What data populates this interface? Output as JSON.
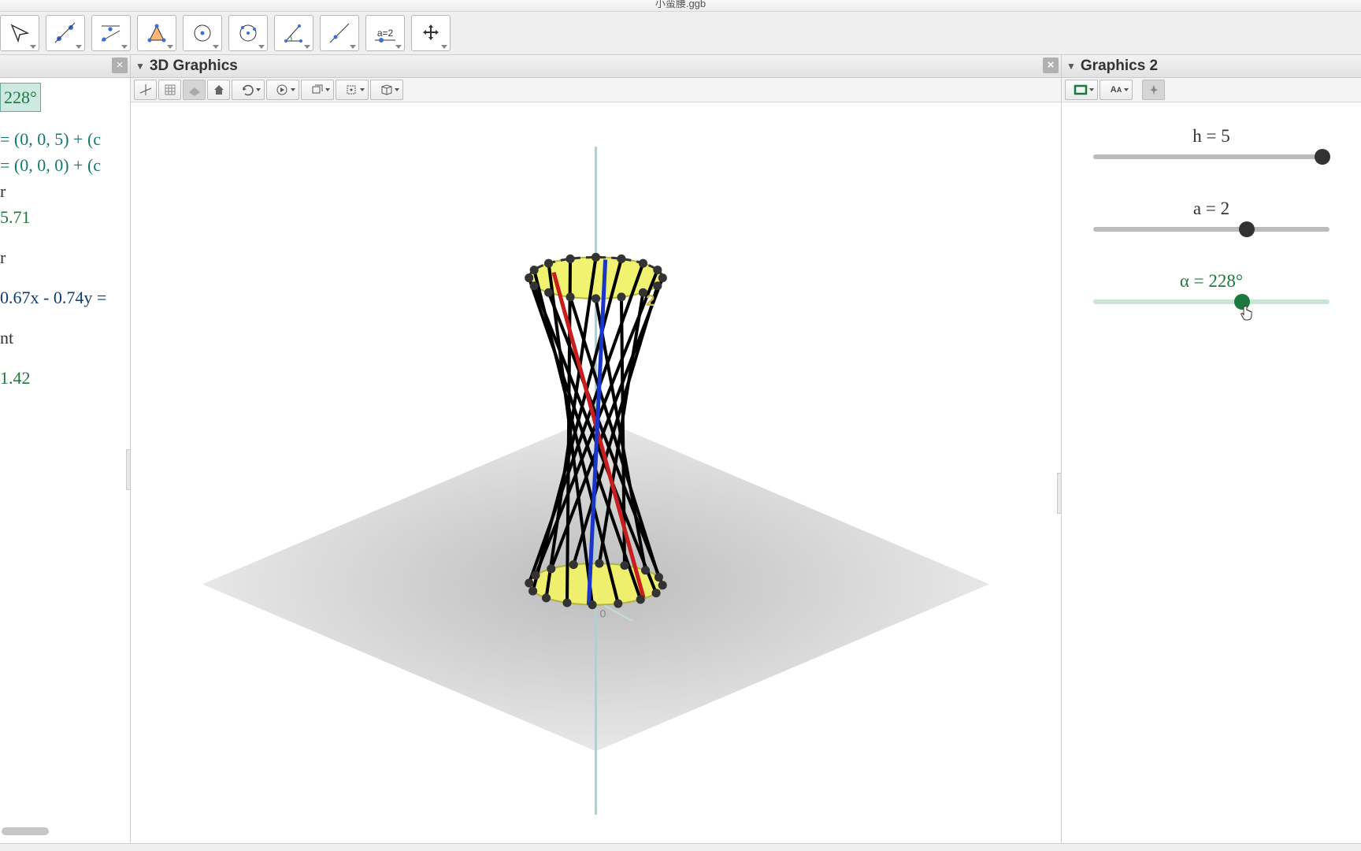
{
  "window": {
    "title": "小蛮腰.ggb"
  },
  "toolbar": [
    {
      "name": "move-tool"
    },
    {
      "name": "point-tool"
    },
    {
      "name": "line-tool"
    },
    {
      "name": "perpendicular-tool"
    },
    {
      "name": "polygon-tool"
    },
    {
      "name": "circle-tool"
    },
    {
      "name": "conic-tool"
    },
    {
      "name": "angle-tool"
    },
    {
      "name": "slider-tool",
      "label": "a=2"
    },
    {
      "name": "pan-tool"
    }
  ],
  "panels": {
    "algebra": {
      "close_label": "×",
      "lines": [
        {
          "text": "228°",
          "cls": "alg-green alg-high"
        },
        {
          "text": "",
          "cls": ""
        },
        {
          "text": " = (0, 0, 5) + (c",
          "cls": "alg-teal"
        },
        {
          "text": " = (0, 0, 0) + (c",
          "cls": "alg-teal"
        },
        {
          "text": "r",
          "cls": ""
        },
        {
          "text": "5.71",
          "cls": "alg-green"
        },
        {
          "text": "",
          "cls": ""
        },
        {
          "text": "r",
          "cls": ""
        },
        {
          "text": "",
          "cls": ""
        },
        {
          "text": "0.67x - 0.74y =",
          "cls": "alg-dark"
        },
        {
          "text": "",
          "cls": ""
        },
        {
          "text": "nt",
          "cls": ""
        },
        {
          "text": "",
          "cls": ""
        },
        {
          "text": "1.42",
          "cls": "alg-green"
        }
      ]
    },
    "view3d": {
      "title": "3D Graphics",
      "sub_buttons": [
        "axes",
        "grid",
        "plane",
        "home",
        "rot",
        "anim",
        "proj",
        "clip",
        "view"
      ],
      "points_label": "2"
    },
    "graphics2": {
      "title": "Graphics 2",
      "sliders": [
        {
          "name": "h",
          "label": "h = 5",
          "value": 5,
          "min": 0,
          "max": 5,
          "pos": 0.97,
          "color": "dark"
        },
        {
          "name": "a",
          "label": "a = 2",
          "value": 2,
          "min": 0,
          "max": 3,
          "pos": 0.65,
          "color": "dark"
        },
        {
          "name": "alpha",
          "label": "α = 228°",
          "value": 228,
          "min": 0,
          "max": 360,
          "pos": 0.63,
          "color": "green"
        }
      ]
    }
  },
  "chart_data": {
    "type": "other",
    "description": "3D hyperboloid / ruled surface made of straight segments between two circles",
    "parameters": {
      "h": 5,
      "a": 2,
      "alpha_deg": 228,
      "segments": 16
    },
    "top_circle_center": [
      0,
      0,
      5
    ],
    "bottom_circle_center": [
      0,
      0,
      0
    ],
    "radius": 2,
    "perimeter": 5.71,
    "plane_equation": "0.67x − 0.74y = ...",
    "focus_value": 1.42,
    "highlights": [
      {
        "color": "red",
        "index": 3
      },
      {
        "color": "blue",
        "index": 5
      }
    ]
  }
}
